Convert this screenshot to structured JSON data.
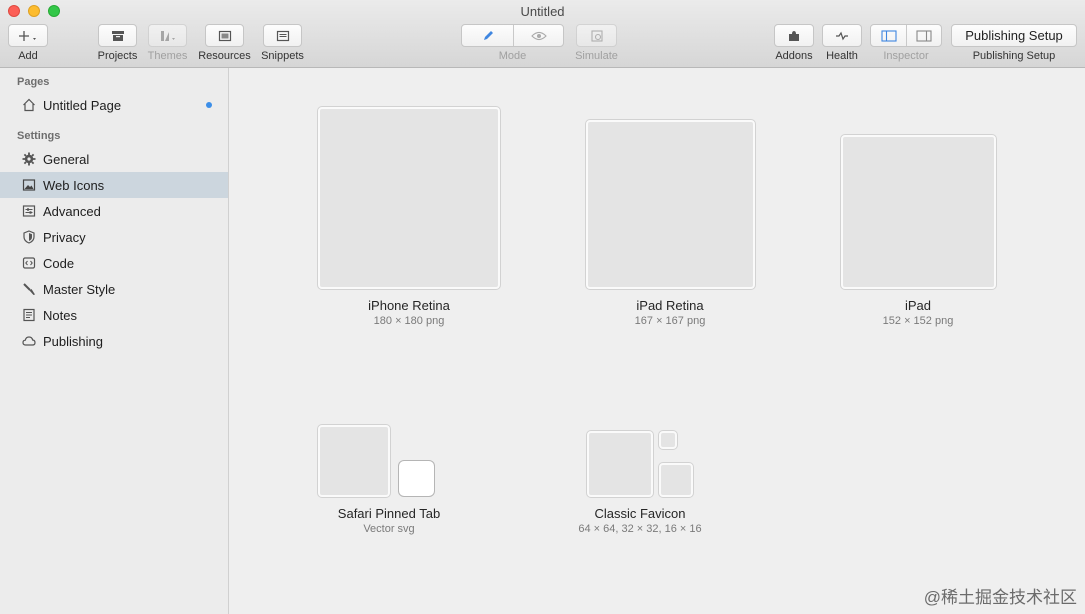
{
  "window": {
    "title": "Untitled"
  },
  "toolbar": {
    "add": "Add",
    "projects": "Projects",
    "themes": "Themes",
    "resources": "Resources",
    "snippets": "Snippets",
    "mode": "Mode",
    "simulate": "Simulate",
    "addons": "Addons",
    "health": "Health",
    "inspector": "Inspector",
    "publishing_setup_button": "Publishing Setup",
    "publishing_setup_label": "Publishing Setup"
  },
  "sidebar": {
    "pages_heading": "Pages",
    "page_item": "Untitled Page",
    "settings_heading": "Settings",
    "items": [
      {
        "label": "General",
        "icon": "gear-icon"
      },
      {
        "label": "Web Icons",
        "icon": "image-icon"
      },
      {
        "label": "Advanced",
        "icon": "sliders-icon"
      },
      {
        "label": "Privacy",
        "icon": "shield-icon"
      },
      {
        "label": "Code",
        "icon": "code-icon"
      },
      {
        "label": "Master Style",
        "icon": "brush-icon"
      },
      {
        "label": "Notes",
        "icon": "notes-icon"
      },
      {
        "label": "Publishing",
        "icon": "cloud-icon"
      }
    ],
    "selected": "Web Icons"
  },
  "icons": [
    {
      "title": "iPhone Retina",
      "subtitle": "180 × 180 png"
    },
    {
      "title": "iPad Retina",
      "subtitle": "167 × 167 png"
    },
    {
      "title": "iPad",
      "subtitle": "152 × 152 png"
    },
    {
      "title": "Safari Pinned Tab",
      "subtitle": "Vector svg"
    },
    {
      "title": "Classic Favicon",
      "subtitle": "64 × 64, 32 × 32, 16 × 16"
    }
  ],
  "watermark": "@稀土掘金技术社区",
  "colors": {
    "selection": "#ccd6de",
    "accent_dot": "#3c8ee8",
    "close": "#fc5f57",
    "minimize": "#fdbc2e",
    "zoom": "#33c748"
  }
}
